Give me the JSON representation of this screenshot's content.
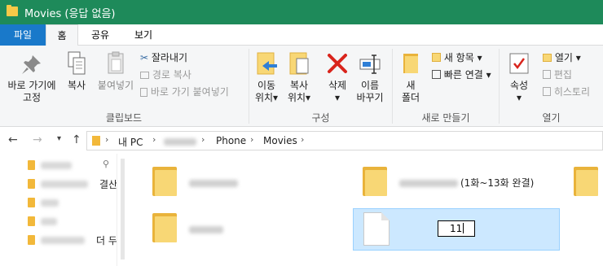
{
  "window": {
    "title": "Movies (응답 없음)"
  },
  "tabs": {
    "file": "파일",
    "home": "홈",
    "share": "공유",
    "view": "보기"
  },
  "ribbon": {
    "clipboard": {
      "pin_label": "바로 가기에\n고정",
      "copy_label": "복사",
      "paste_label": "붙여넣기",
      "cut_label": "잘라내기",
      "copy_path_label": "경로 복사",
      "paste_shortcut_label": "바로 가기 붙여넣기",
      "group_label": "클립보드"
    },
    "organize": {
      "move_label": "이동\n위치",
      "copy_to_label": "복사\n위치",
      "delete_label": "삭제",
      "rename_label": "이름\n바꾸기",
      "group_label": "구성"
    },
    "new": {
      "new_folder_label": "새\n폴더",
      "new_item_label": "새 항목",
      "easy_access_label": "빠른 연결",
      "group_label": "새로 만들기"
    },
    "open": {
      "properties_label": "속성",
      "open_label": "열기",
      "edit_label": "편집",
      "history_label": "히스토리",
      "group_label": "열기"
    },
    "dropdown_glyph": "▾"
  },
  "address": {
    "back_glyph": "←",
    "forward_glyph": "→",
    "recent_glyph": "▾",
    "up_glyph": "↑",
    "crumbs": [
      "내 PC",
      "Phone",
      "Movies"
    ]
  },
  "navpane": {
    "items": [
      {
        "tail": ""
      },
      {
        "tail": "결산"
      },
      {
        "tail": ""
      },
      {
        "tail": ""
      },
      {
        "tail": "더 두"
      }
    ],
    "pin_glyph": "📌"
  },
  "content": {
    "folder_2_suffix": "(1화~13화 완결)",
    "rename_value": "11"
  },
  "colors": {
    "titlebar": "#1e8a5a",
    "file_tab": "#1979ca",
    "selection": "#cce8ff"
  }
}
